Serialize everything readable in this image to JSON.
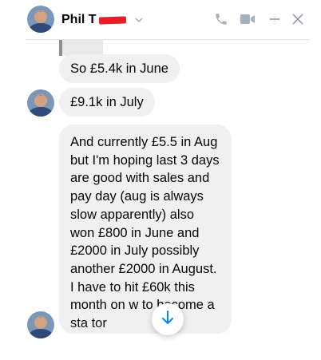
{
  "header": {
    "contact_name": "Phil T",
    "icons": [
      "phone-icon",
      "video-icon",
      "minimize-icon",
      "close-icon",
      "chevron-down-icon"
    ]
  },
  "messages": [
    {
      "text": "So £5.4k in June"
    },
    {
      "text": "£9.1k in July"
    },
    {
      "text": "And currently £5.5 in Aug but I'm hoping last 3 days are good with sales and pay day (aug is always slow apparently) also won £800 in June and £2000 in July possibly another £2000 in August. I have to hit £60k this month on  w to become a sta   tor"
    }
  ],
  "colors": {
    "bubble_bg": "#f0f0f0",
    "accent": "#0084ff",
    "icon_grey": "#a8b0b9",
    "redaction": "#e3202a"
  }
}
